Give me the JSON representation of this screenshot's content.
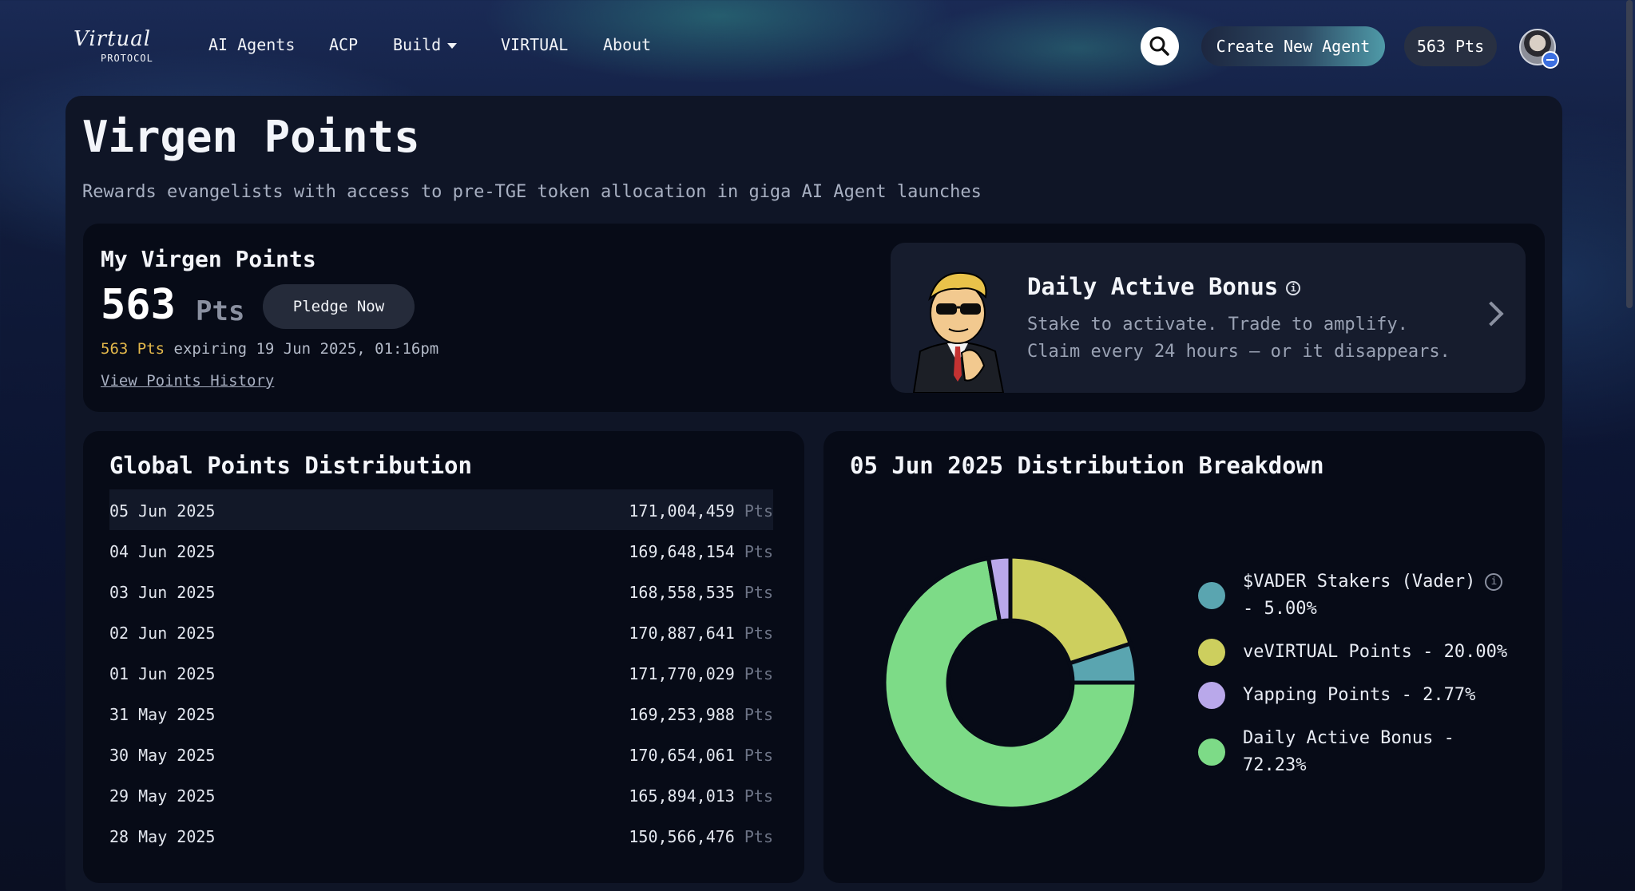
{
  "nav": {
    "logo_script": "Virtual",
    "logo_sub": "PROTOCOL",
    "links": [
      "AI Agents",
      "ACP",
      "Build",
      "VIRTUAL",
      "About"
    ],
    "create_label": "Create New Agent",
    "points_label": "563 Pts"
  },
  "page": {
    "title": "Virgen Points",
    "subtitle": "Rewards evangelists with access to pre-TGE token allocation in giga AI Agent launches"
  },
  "my_points": {
    "title": "My Virgen Points",
    "value": "563",
    "unit": "Pts",
    "pledge_label": "Pledge Now",
    "expiring_pts": "563 Pts",
    "expiring_text": " expiring 19 Jun 2025, 01:16pm",
    "history_label": "View Points History"
  },
  "bonus": {
    "title": "Daily Active Bonus",
    "desc1": "Stake to activate. Trade to amplify.",
    "desc2": "Claim every 24 hours — or it disappears."
  },
  "global": {
    "title": "Global Points Distribution",
    "unit": "Pts",
    "rows": [
      {
        "date": "05 Jun 2025",
        "value": "171,004,459"
      },
      {
        "date": "04 Jun 2025",
        "value": "169,648,154"
      },
      {
        "date": "03 Jun 2025",
        "value": "168,558,535"
      },
      {
        "date": "02 Jun 2025",
        "value": "170,887,641"
      },
      {
        "date": "01 Jun 2025",
        "value": "171,770,029"
      },
      {
        "date": "31 May 2025",
        "value": "169,253,988"
      },
      {
        "date": "30 May 2025",
        "value": "170,654,061"
      },
      {
        "date": "29 May 2025",
        "value": "165,894,013"
      },
      {
        "date": "28 May 2025",
        "value": "150,566,476"
      }
    ]
  },
  "breakdown": {
    "title": "05 Jun 2025 Distribution Breakdown",
    "legend": [
      {
        "label_line1": "$VADER Stakers (Vader)",
        "label_line2": "- 5.00%",
        "color": "#5aa5b0"
      },
      {
        "label_line1": "veVIRTUAL Points - 20.00%",
        "label_line2": "",
        "color": "#cdcf5e"
      },
      {
        "label_line1": "Yapping Points - 2.77%",
        "label_line2": "",
        "color": "#b9a8ea"
      },
      {
        "label_line1": "Daily Active Bonus -",
        "label_line2": "72.23%",
        "color": "#7ddb87"
      }
    ]
  },
  "chart_data": {
    "type": "pie",
    "title": "05 Jun 2025 Distribution Breakdown",
    "categories": [
      "$VADER Stakers (Vader)",
      "veVIRTUAL Points",
      "Yapping Points",
      "Daily Active Bonus"
    ],
    "values": [
      5.0,
      20.0,
      2.77,
      72.23
    ],
    "colors": [
      "#5aa5b0",
      "#cdcf5e",
      "#b9a8ea",
      "#7ddb87"
    ],
    "legend_position": "right",
    "donut": true
  }
}
